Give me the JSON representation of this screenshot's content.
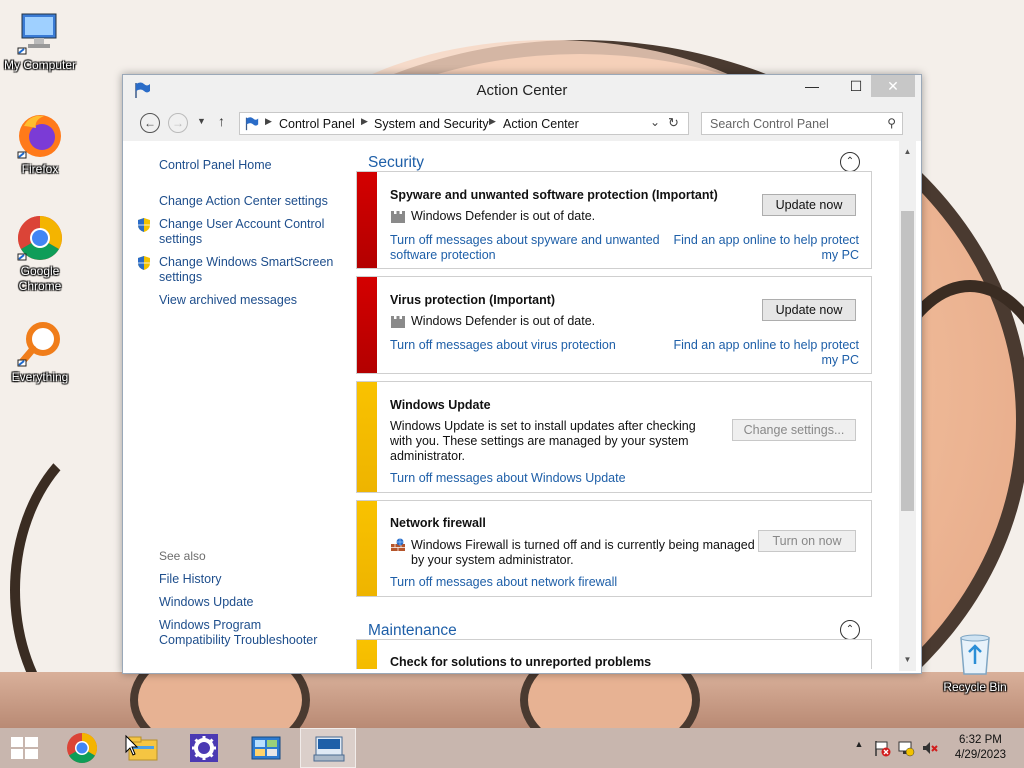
{
  "desktop": {
    "icons": [
      {
        "label": "My Computer"
      },
      {
        "label": "Firefox"
      },
      {
        "label": "Google Chrome"
      },
      {
        "label": "Everything"
      },
      {
        "label": "Recycle Bin"
      }
    ]
  },
  "window": {
    "title": "Action Center",
    "controls": {
      "minimize": "—",
      "maximize": "☐",
      "close": "✕"
    }
  },
  "navbar": {
    "breadcrumbs": [
      "Control Panel",
      "System and Security",
      "Action Center"
    ],
    "search_placeholder": "Search Control Panel"
  },
  "sidebar": {
    "home": "Control Panel Home",
    "links": [
      "Change Action Center settings",
      "Change User Account Control settings",
      "Change Windows SmartScreen settings",
      "View archived messages"
    ],
    "see_also_label": "See also",
    "see_also": [
      "File History",
      "Windows Update",
      "Windows Program Compatibility Troubleshooter"
    ]
  },
  "security": {
    "header": "Security",
    "cards": [
      {
        "title": "Spyware and unwanted software protection  (Important)",
        "status": "Windows Defender is out of date.",
        "button": "Update now",
        "link_off": "Turn off messages about spyware and unwanted software protection",
        "link_find": "Find an app online to help protect my PC",
        "color": "#c80000"
      },
      {
        "title": "Virus protection  (Important)",
        "status": "Windows Defender is out of date.",
        "button": "Update now",
        "link_off": "Turn off messages about virus protection",
        "link_find": "Find an app online to help protect my PC",
        "color": "#c80000"
      },
      {
        "title": "Windows Update",
        "status": "Windows Update is set to install updates after checking with you.  These settings are managed by your system administrator.",
        "button": "Change settings...",
        "link_off": "Turn off messages about Windows Update",
        "color": "#f2b800"
      },
      {
        "title": "Network firewall",
        "status": "Windows Firewall is turned off and is currently being managed by your system administrator.",
        "button": "Turn on now",
        "link_off": "Turn off messages about network firewall",
        "color": "#f2b800"
      }
    ]
  },
  "maintenance": {
    "header": "Maintenance",
    "cards": [
      {
        "title": "Check for solutions to unreported problems",
        "color": "#f2b800"
      }
    ]
  },
  "taskbar": {
    "time": "6:32 PM",
    "date": "4/29/2023",
    "items": [
      "start",
      "chrome",
      "file-explorer",
      "settings",
      "control-panel",
      "on-screen-keyboard"
    ]
  }
}
